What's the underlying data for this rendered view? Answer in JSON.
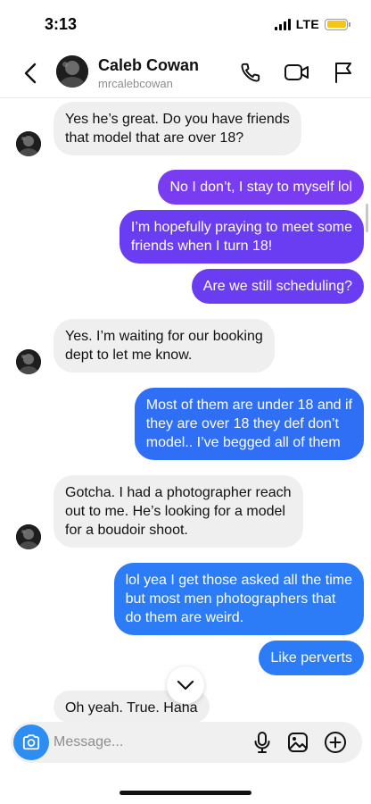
{
  "status_bar": {
    "time": "3:13",
    "network": "LTE",
    "battery_color": "#f5c518"
  },
  "header": {
    "name": "Caleb Cowan",
    "handle": "mrcalebcowan",
    "icons": [
      "back-icon",
      "phone-icon",
      "video-icon",
      "flag-icon"
    ]
  },
  "colors": {
    "incoming_bubble": "#efefef",
    "outgoing_gradient": [
      "#7a3cf0",
      "#6a3df2",
      "#3d5cf5",
      "#2f6ff6",
      "#2b7cf6"
    ],
    "camera_button": "#2c8df2"
  },
  "messages": [
    {
      "from": "them",
      "text": "Yes he’s great. Do you have friends\nthat model that are over 18?"
    },
    {
      "from": "me",
      "text": "No I don’t, I stay to myself lol"
    },
    {
      "from": "me",
      "text": "I’m hopefully praying to meet some\nfriends when I turn 18!"
    },
    {
      "from": "me",
      "text": "Are we still scheduling?"
    },
    {
      "from": "them",
      "text": "Yes. I’m waiting for our booking\ndept to let me know."
    },
    {
      "from": "me",
      "text": "Most of them are under 18 and if\nthey are over 18 they def don’t\nmodel.. I’ve begged all of them"
    },
    {
      "from": "them",
      "text": "Gotcha. I had a photographer reach\nout to me. He’s looking for a model\nfor a boudoir shoot."
    },
    {
      "from": "me",
      "text": "lol yea I get those asked all the time\nbut most men photographers that\ndo them are weird."
    },
    {
      "from": "me",
      "text": "Like perverts"
    },
    {
      "from": "them",
      "text": "Oh yeah. True. Haha"
    }
  ],
  "composer": {
    "placeholder": "Message...",
    "icons": [
      "camera-icon",
      "microphone-icon",
      "gallery-icon",
      "plus-icon"
    ]
  }
}
